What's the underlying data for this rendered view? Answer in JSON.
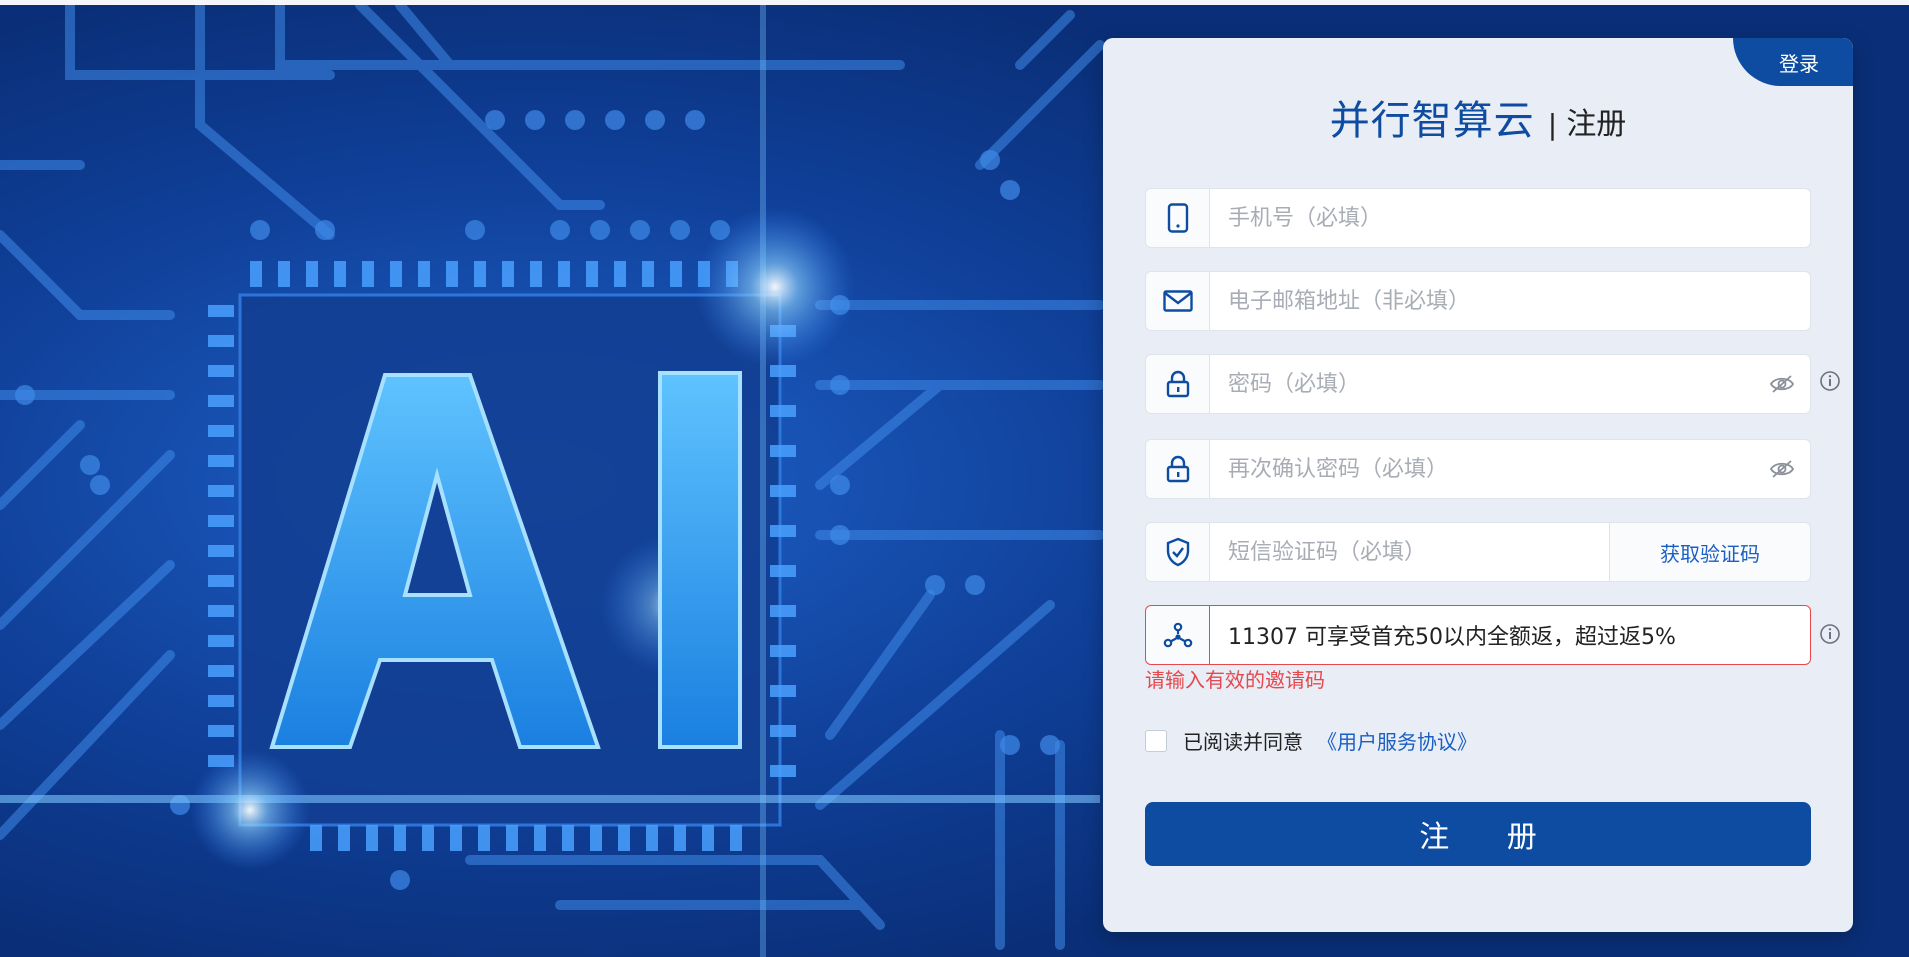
{
  "header": {
    "login_label": "登录",
    "brand": "并行智算云",
    "separator": "|",
    "subtitle": "注册"
  },
  "hero": {
    "text": "AI"
  },
  "form": {
    "phone": {
      "placeholder": "手机号（必填）",
      "value": ""
    },
    "email": {
      "placeholder": "电子邮箱地址（非必填）",
      "value": ""
    },
    "password": {
      "placeholder": "密码（必填）",
      "value": ""
    },
    "confirm_password": {
      "placeholder": "再次确认密码（必填）",
      "value": ""
    },
    "sms_code": {
      "placeholder": "短信验证码（必填）",
      "value": "",
      "get_code_label": "获取验证码"
    },
    "invite_code": {
      "value": "11307 可享受首充50以内全额返，超过返5%",
      "error": "请输入有效的邀请码"
    },
    "agreement": {
      "checked": false,
      "text": "已阅读并同意",
      "link": "《用户服务协议》"
    },
    "submit_label": "注 册"
  },
  "colors": {
    "primary": "#0d4ca0",
    "link": "#1a5fc4",
    "error": "#e5484d",
    "card_bg": "#e9edf5"
  }
}
